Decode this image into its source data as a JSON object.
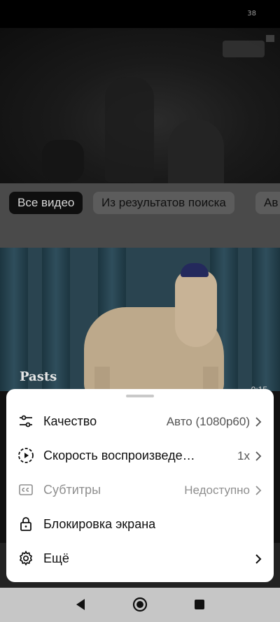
{
  "status_bar": {
    "time": "38"
  },
  "chips": [
    "Все видео",
    "Из результатов поиска",
    "Ав"
  ],
  "video_overlay": {
    "title": "Pasts",
    "duration": "0:15"
  },
  "menu": {
    "items": [
      {
        "label": "Качество",
        "value": "Авто (1080p60)",
        "icon": "tune-icon",
        "disabled": false
      },
      {
        "label": "Скорость воспроизведе…",
        "value": "1x",
        "icon": "playback-speed-icon",
        "disabled": false
      },
      {
        "label": "Субтитры",
        "value": "Недоступно",
        "icon": "captions-icon",
        "disabled": true
      },
      {
        "label": "Блокировка экрана",
        "value": "",
        "icon": "lock-icon",
        "disabled": false
      },
      {
        "label": "Ещё",
        "value": "",
        "icon": "gear-icon",
        "disabled": false
      }
    ]
  },
  "colors": {
    "sheet_bg": "#ffffff",
    "nav_bg": "#c6c6c6",
    "chip_active_bg": "#0f0f0f"
  },
  "nav": {
    "buttons": [
      "back-icon",
      "home-icon",
      "recents-icon"
    ]
  }
}
